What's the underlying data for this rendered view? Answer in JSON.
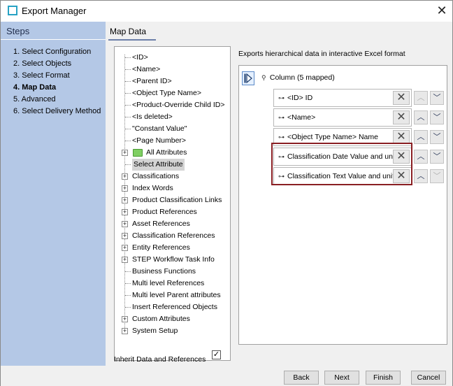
{
  "window": {
    "title": "Export Manager"
  },
  "steps": {
    "header": "Steps",
    "items": [
      {
        "label": "1. Select Configuration",
        "active": false
      },
      {
        "label": "2. Select Objects",
        "active": false
      },
      {
        "label": "3. Select Format",
        "active": false
      },
      {
        "label": "4. Map Data",
        "active": true
      },
      {
        "label": "5. Advanced",
        "active": false
      },
      {
        "label": "6. Select Delivery Method",
        "active": false
      }
    ]
  },
  "main": {
    "title": "Map Data",
    "description": "Exports hierarchical data in interactive Excel format",
    "tree": [
      {
        "label": "<ID>",
        "expandable": false
      },
      {
        "label": "<Name>",
        "expandable": false
      },
      {
        "label": "<Parent ID>",
        "expandable": false
      },
      {
        "label": "<Object Type Name>",
        "expandable": false
      },
      {
        "label": "<Product-Override Child ID>",
        "expandable": false
      },
      {
        "label": "<Is deleted>",
        "expandable": false
      },
      {
        "label": "\"Constant Value\"",
        "expandable": false
      },
      {
        "label": "<Page Number>",
        "expandable": false
      },
      {
        "label": "All Attributes",
        "expandable": true,
        "folder": true
      },
      {
        "label": "Select Attribute",
        "expandable": false,
        "selected": true
      },
      {
        "label": "Classifications",
        "expandable": true
      },
      {
        "label": "Index Words",
        "expandable": true
      },
      {
        "label": "Product Classification Links",
        "expandable": true
      },
      {
        "label": "Product References",
        "expandable": true
      },
      {
        "label": "Asset References",
        "expandable": true
      },
      {
        "label": "Classification References",
        "expandable": true
      },
      {
        "label": "Entity References",
        "expandable": true
      },
      {
        "label": "STEP Workflow Task Info",
        "expandable": true
      },
      {
        "label": "Business Functions",
        "expandable": false
      },
      {
        "label": "Multi level References",
        "expandable": false
      },
      {
        "label": "Multi level Parent attributes",
        "expandable": false
      },
      {
        "label": "Insert Referenced Objects",
        "expandable": false
      },
      {
        "label": "Custom Attributes",
        "expandable": true
      },
      {
        "label": "System Setup",
        "expandable": true
      }
    ],
    "inherit_label": "Inherit Data and References",
    "inherit_checked": "✓",
    "mapping": {
      "root_label": "Column (5 mapped)",
      "rows": [
        {
          "label": "<ID> ID",
          "up_disabled": true,
          "down_disabled": false
        },
        {
          "label": "<Name>",
          "up_disabled": false,
          "down_disabled": false
        },
        {
          "label": "<Object Type Name> Name",
          "up_disabled": false,
          "down_disabled": false
        },
        {
          "label": "Classification Date Value and unit",
          "up_disabled": false,
          "down_disabled": false
        },
        {
          "label": "Classification Text Value and unit",
          "up_disabled": false,
          "down_disabled": true
        }
      ]
    }
  },
  "footer": {
    "back": "Back",
    "next": "Next",
    "finish": "Finish",
    "cancel": "Cancel"
  },
  "icons": {
    "close": "close-icon",
    "expander": "plus-icon",
    "folder": "folder-icon",
    "key": "key-icon",
    "delete": "x-icon",
    "up": "chevron-up-icon",
    "down": "chevron-down-icon",
    "play": "play-icon"
  },
  "colors": {
    "steps_bg": "#b4c8e6",
    "highlight": "#8a1f23",
    "accent": "#27a2c4"
  }
}
